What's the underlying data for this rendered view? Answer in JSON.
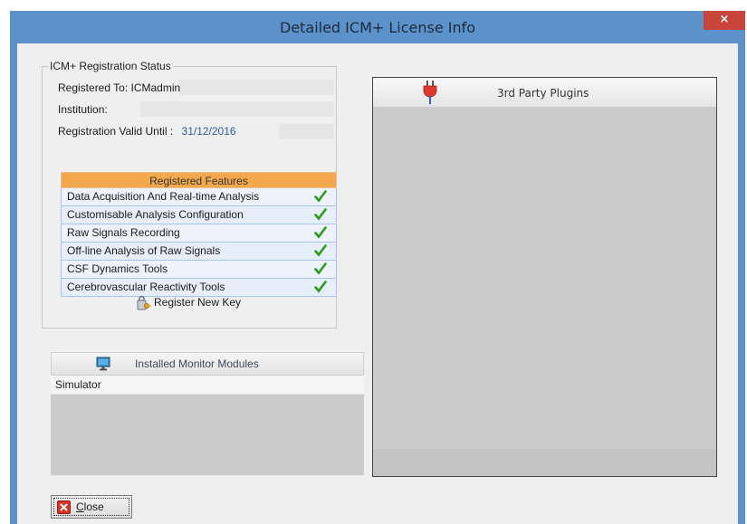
{
  "window": {
    "title": "Detailed ICM+ License Info",
    "close_glyph": "×"
  },
  "registration": {
    "group_title": "ICM+ Registration Status",
    "registered_to": "Registered To: ICMadmin",
    "institution": "Institution:",
    "valid_until_label": "Registration Valid Until :",
    "valid_until_value": "31/12/2016"
  },
  "features": {
    "header": "Registered Features",
    "items": [
      "Data Acquisition And Real-time Analysis",
      "Customisable Analysis Configuration",
      "Raw Signals Recording",
      "Off-line Analysis of Raw Signals",
      "CSF Dynamics Tools",
      "Cerebrovascular Reactivity Tools"
    ],
    "check_icon": "check-icon",
    "check_color": "#2e9a1e"
  },
  "register_button": {
    "label": "Register New Key",
    "icon": "key-lock-icon"
  },
  "monitor_modules": {
    "header": "Installed Monitor Modules",
    "icon": "monitor-icon",
    "items": [
      "Simulator"
    ]
  },
  "plugins": {
    "header": "3rd Party Plugins",
    "icon": "plug-icon"
  },
  "close_button": {
    "label_accel": "C",
    "label_rest": "lose",
    "icon": "close-x-icon"
  },
  "colors": {
    "titlebar": "#5b92c9",
    "close": "#c9443a",
    "feature_header": "#f3a84d"
  }
}
